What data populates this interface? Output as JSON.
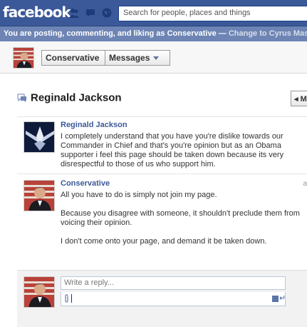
{
  "topbar": {
    "logo": "facebook",
    "search_placeholder": "Search for people, places and things"
  },
  "notice": {
    "text": "You are posting, commenting, and liking as Conservative — ",
    "link": "Change to Cyrus Massoumi"
  },
  "page_header": {
    "page_button": "Conservative",
    "messages_button": "Messages"
  },
  "thread": {
    "title": "Reginald Jackson",
    "nav_button_label": "M",
    "messages": [
      {
        "author": "Reginald Jackson",
        "paragraphs": [
          "I completely understand that you have you're dislike towards our Commander in Chief and that's you're opinion but as an Obama supporter i feel this page should be taken down because its very disrespectful to those of us who support him."
        ],
        "time": ""
      },
      {
        "author": "Conservative",
        "paragraphs": [
          "All you have to do is simply not join my page.",
          "Because you disagree with someone, it shouldn't preclude them from voicing their opinion.",
          "I don't come onto your page, and demand it be taken down."
        ],
        "time": "a"
      }
    ]
  },
  "reply": {
    "placeholder": "Write a reply..."
  },
  "colors": {
    "brand": "#3b5998",
    "notice": "#6d84b4"
  },
  "icons": [
    "friends-icon",
    "messages-icon",
    "globe-icon",
    "message-bubble-icon",
    "paperclip-icon",
    "checkbox-icon",
    "enter-key-icon"
  ]
}
